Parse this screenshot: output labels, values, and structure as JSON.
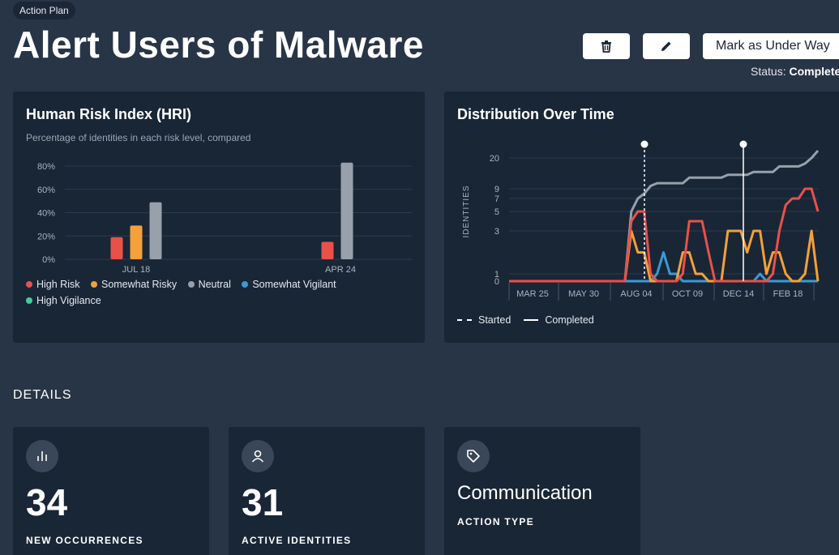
{
  "header": {
    "badge": "Action Plan",
    "title": "Alert Users of Malware",
    "mark_button_label": "Mark as Under Way",
    "status_label": "Status:",
    "status_value": "Completed"
  },
  "hri_card": {
    "title": "Human Risk Index (HRI)",
    "subtitle": "Percentage of identities in each risk level, compared"
  },
  "distribution_card": {
    "title": "Distribution Over Time",
    "legend_started": "Started",
    "legend_completed": "Completed"
  },
  "details": {
    "section_title": "DETAILS",
    "cards": [
      {
        "icon": "bar-chart-icon",
        "value": "34",
        "label": "NEW OCCURRENCES"
      },
      {
        "icon": "user-icon",
        "value": "31",
        "label": "ACTIVE IDENTITIES"
      },
      {
        "icon": "tag-icon",
        "value": "Communication",
        "label": "ACTION TYPE"
      }
    ]
  },
  "colors": {
    "high_risk": "#e8514a",
    "somewhat_risky": "#f5a03a",
    "neutral": "#98a1ab",
    "somewhat_vigilant": "#3a9ad6",
    "high_vigilance": "#3fcf9b"
  },
  "chart_data": [
    {
      "type": "bar",
      "title": "Human Risk Index (HRI)",
      "categories": [
        "JUL 18",
        "APR 24"
      ],
      "series": [
        {
          "name": "High Risk",
          "values": [
            19,
            15
          ]
        },
        {
          "name": "Somewhat Risky",
          "values": [
            29,
            0
          ]
        },
        {
          "name": "Neutral",
          "values": [
            49,
            83
          ]
        },
        {
          "name": "Somewhat Vigilant",
          "values": [
            0,
            0
          ]
        },
        {
          "name": "High Vigilance",
          "values": [
            0,
            0
          ]
        }
      ],
      "yticks": [
        "0%",
        "20%",
        "40%",
        "60%",
        "80%"
      ],
      "ylim": [
        0,
        90
      ]
    },
    {
      "type": "line",
      "title": "Distribution Over Time",
      "ylabel": "IDENTITIES",
      "xticks": [
        "MAR 25",
        "MAY 30",
        "AUG 04",
        "OCT 09",
        "DEC 14",
        "FEB 18"
      ],
      "yticks": [
        0,
        1,
        3,
        5,
        7,
        9,
        20
      ],
      "series": [
        {
          "name": "Neutral",
          "values": [
            0,
            0,
            0,
            0,
            0,
            0,
            0,
            0,
            0,
            0,
            0,
            0,
            0,
            0,
            0,
            0,
            0,
            0,
            0,
            5,
            7,
            8,
            10,
            11,
            11,
            11,
            11,
            11,
            13,
            13,
            13,
            13,
            13,
            13,
            14,
            14,
            14,
            14,
            15,
            15,
            15,
            15,
            17,
            17,
            17,
            17,
            18,
            20,
            23
          ]
        },
        {
          "name": "High Risk",
          "values": [
            0,
            0,
            0,
            0,
            0,
            0,
            0,
            0,
            0,
            0,
            0,
            0,
            0,
            0,
            0,
            0,
            0,
            0,
            0,
            4,
            5,
            5,
            1,
            0,
            0,
            0,
            0,
            1,
            4,
            4,
            4,
            2,
            0,
            0,
            0,
            0,
            0,
            0,
            0,
            0,
            0,
            1,
            3,
            6,
            7,
            7,
            9,
            9,
            5
          ]
        },
        {
          "name": "Somewhat Risky",
          "values": [
            0,
            0,
            0,
            0,
            0,
            0,
            0,
            0,
            0,
            0,
            0,
            0,
            0,
            0,
            0,
            0,
            0,
            0,
            0,
            3,
            2,
            2,
            0,
            0,
            0,
            0,
            0,
            2,
            2,
            1,
            1,
            0,
            0,
            0,
            3,
            3,
            3,
            2,
            3,
            3,
            1,
            2,
            2,
            1,
            0,
            0,
            1,
            3,
            0
          ]
        },
        {
          "name": "Somewhat Vigilant",
          "values": [
            0,
            0,
            0,
            0,
            0,
            0,
            0,
            0,
            0,
            0,
            0,
            0,
            0,
            0,
            0,
            0,
            0,
            0,
            0,
            0,
            0,
            0,
            0,
            1,
            2,
            1,
            1,
            0,
            0,
            0,
            0,
            0,
            0,
            0,
            0,
            0,
            0,
            0,
            0,
            1,
            0,
            0,
            0,
            0,
            0,
            0,
            0,
            0,
            0
          ]
        }
      ],
      "markers": [
        {
          "name": "Started",
          "style": "dashed",
          "at": "AUG 04"
        },
        {
          "name": "Completed",
          "style": "solid",
          "at": "DEC 14"
        }
      ]
    }
  ]
}
